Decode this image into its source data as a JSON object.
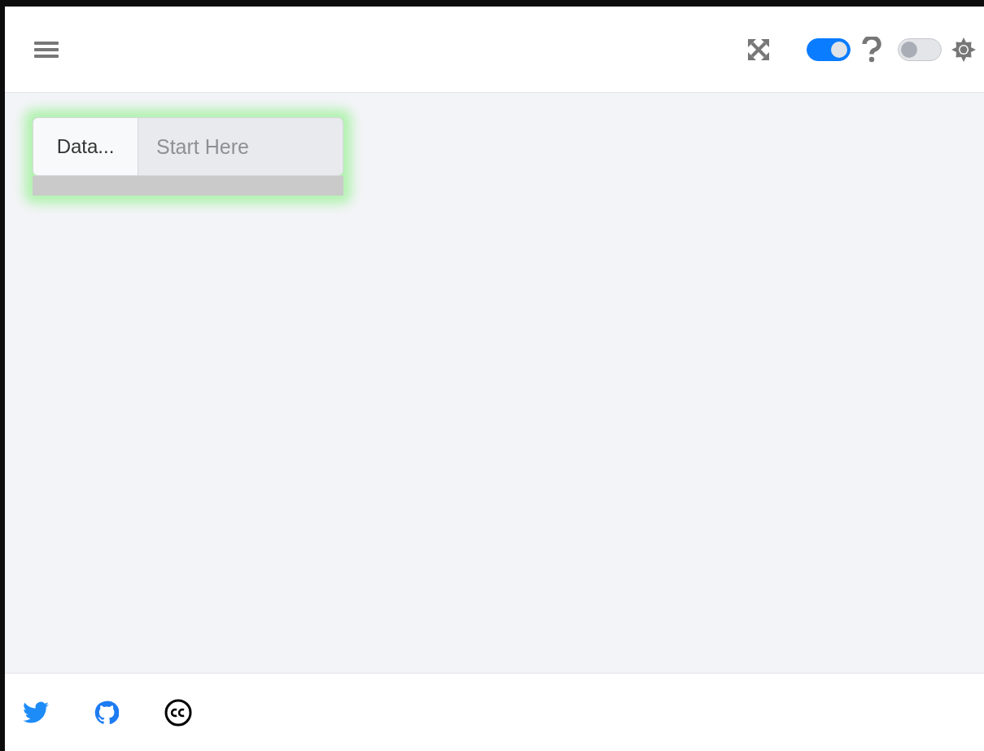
{
  "header": {
    "toggles": [
      {
        "on": true
      },
      {
        "on": false
      }
    ]
  },
  "card": {
    "label": "Data...",
    "input": {
      "placeholder": "Start Here"
    }
  },
  "footer": {
    "links": [
      {
        "kind": "twitter"
      },
      {
        "kind": "github"
      },
      {
        "kind": "license"
      }
    ]
  }
}
